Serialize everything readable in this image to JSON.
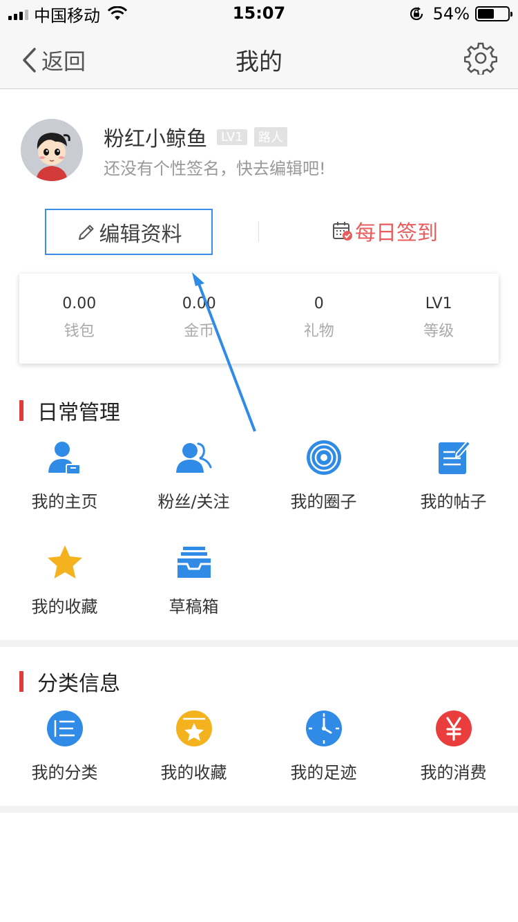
{
  "status_bar": {
    "carrier": "中国移动",
    "time": "15:07",
    "battery_percent": "54%",
    "battery_level": 0.54
  },
  "nav": {
    "back_label": "返回",
    "title": "我的"
  },
  "profile": {
    "name": "粉红小鲸鱼",
    "level_badge": "LV1",
    "role_badge": "路人",
    "signature": "还没有个性签名，快去编辑吧!",
    "edit_label": "编辑资料",
    "signin_label": "每日签到"
  },
  "stats": [
    {
      "value": "0.00",
      "label": "钱包"
    },
    {
      "value": "0.00",
      "label": "金币"
    },
    {
      "value": "0",
      "label": "礼物"
    },
    {
      "value": "LV1",
      "label": "等级"
    }
  ],
  "daily": {
    "title": "日常管理",
    "items": [
      {
        "label": "我的主页",
        "icon": "user-card-icon"
      },
      {
        "label": "粉丝/关注",
        "icon": "users-icon"
      },
      {
        "label": "我的圈子",
        "icon": "circle-target-icon"
      },
      {
        "label": "我的帖子",
        "icon": "edit-note-icon"
      },
      {
        "label": "我的收藏",
        "icon": "star-icon"
      },
      {
        "label": "草稿箱",
        "icon": "inbox-tray-icon"
      }
    ]
  },
  "category": {
    "title": "分类信息",
    "items": [
      {
        "label": "我的分类",
        "icon": "list-icon"
      },
      {
        "label": "我的收藏",
        "icon": "folder-star-icon"
      },
      {
        "label": "我的足迹",
        "icon": "clock-icon"
      },
      {
        "label": "我的消费",
        "icon": "yen-icon"
      }
    ]
  },
  "colors": {
    "accent_blue": "#3a8ee6",
    "accent_red": "#e23b3b",
    "signin_red": "#e85c5c",
    "star_yellow": "#f5b21f"
  }
}
